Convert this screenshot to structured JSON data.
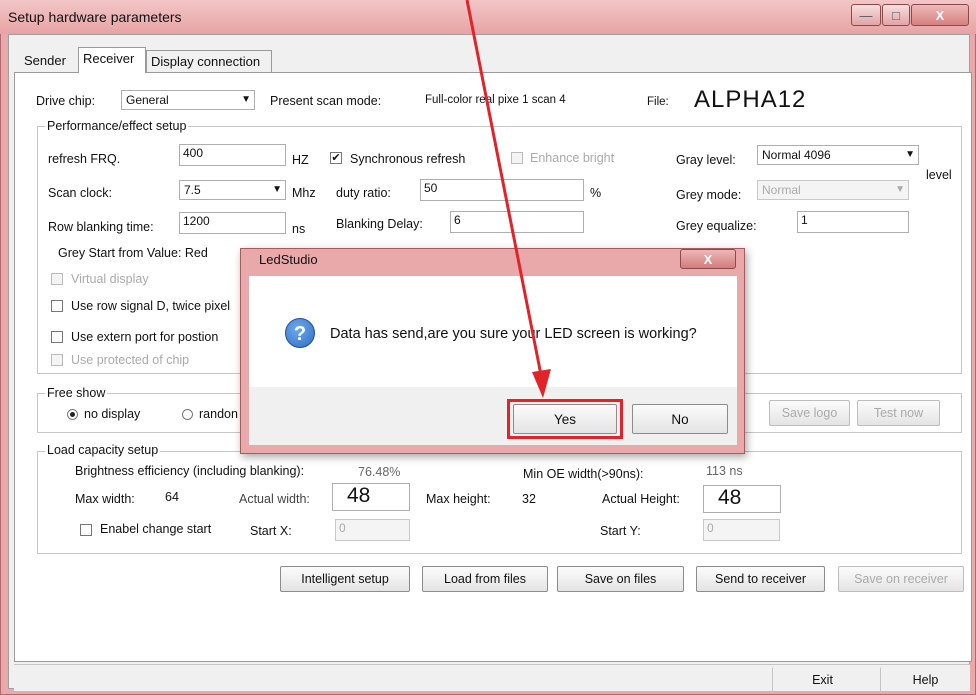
{
  "window": {
    "title": "Setup hardware parameters",
    "min": "—",
    "max": "□",
    "close": "X"
  },
  "tabs": [
    "Sender",
    "Receiver",
    "Display connection"
  ],
  "top": {
    "drive_chip_label": "Drive chip:",
    "drive_chip_value": "General",
    "scan_mode_label": "Present scan mode:",
    "scan_mode_value": "Full-color real pixe 1 scan 4",
    "file_label": "File:",
    "file_value": "ALPHA12"
  },
  "performance": {
    "title": "Performance/effect setup",
    "refresh_label": "refresh FRQ.",
    "refresh_value": "400",
    "refresh_unit": "HZ",
    "sync_label": "Synchronous refresh",
    "sync_checked": "✔",
    "enhance_label": "Enhance bright",
    "gray_level_label": "Gray level:",
    "gray_level_value": "Normal 4096",
    "level_label": "level",
    "scan_clock_label": "Scan clock:",
    "scan_clock_value": "7.5",
    "scan_clock_unit": "Mhz",
    "duty_label": "duty ratio:",
    "duty_value": "50",
    "duty_unit": "%",
    "grey_mode_label": "Grey mode:",
    "grey_mode_value": "Normal",
    "row_blank_label": "Row blanking time:",
    "row_blank_value": "1200",
    "row_blank_unit": "ns",
    "blank_delay_label": "Blanking Delay:",
    "blank_delay_value": "6",
    "grey_equalize_label": "Grey equalize:",
    "grey_equalize_value": "1",
    "grey_start_label": "Grey Start from Value: Red",
    "virtual_label": "Virtual display",
    "row_signal_label": "Use row signal D, twice pixel",
    "extern_port_label": "Use extern port for postion",
    "protected_label": "Use protected of chip"
  },
  "free_show": {
    "title": "Free show",
    "no_display": "no display",
    "random": "randon",
    "save_logo": "Save logo",
    "test_now": "Test now"
  },
  "load": {
    "title": "Load capacity setup",
    "brightness_label": "Brightness efficiency (including blanking):",
    "brightness_value": "76.48%",
    "min_oe_label": "Min OE width(>90ns):",
    "min_oe_value": "113 ns",
    "max_width_label": "Max width:",
    "max_width_value": "64",
    "actual_width_label": "Actual width:",
    "actual_width_value": "48",
    "max_height_label": "Max height:",
    "max_height_value": "32",
    "actual_height_label": "Actual Height:",
    "actual_height_value": "48",
    "change_start_label": "Enabel change start",
    "start_x_label": "Start X:",
    "start_x_value": "0",
    "start_y_label": "Start Y:",
    "start_y_value": "0"
  },
  "actions": [
    "Intelligent setup",
    "Load from files",
    "Save on files",
    "Send to receiver",
    "Save on receiver"
  ],
  "footer": {
    "exit": "Exit",
    "help": "Help"
  },
  "dialog": {
    "title": "LedStudio",
    "close": "X",
    "icon": "?",
    "message": "Data has send,are you sure your LED screen is working?",
    "yes": "Yes",
    "no": "No"
  },
  "colors": {
    "frame": "#e9a9ab",
    "annotation": "#e0242a",
    "question_icon": "#2f6fc0"
  }
}
